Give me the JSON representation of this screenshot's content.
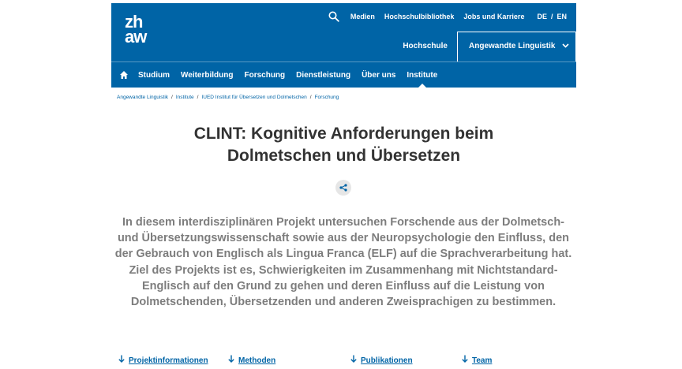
{
  "logo": {
    "line1": "zh",
    "line2": "aw"
  },
  "top_links": {
    "medien": "Medien",
    "bibliothek": "Hochschulbibliothek",
    "jobs": "Jobs und Karriere",
    "lang_de": "DE",
    "lang_sep": "/",
    "lang_en": "EN"
  },
  "subnav": {
    "hochschule": "Hochschule",
    "department": "Angewandte Linguistik"
  },
  "main_nav": {
    "items": [
      "Studium",
      "Weiterbildung",
      "Forschung",
      "Dienstleistung",
      "Über uns",
      "Institute"
    ],
    "active": "Institute"
  },
  "breadcrumb": {
    "items": [
      "Angewandte Linguistik",
      "Institute",
      "IUED Institut für Übersetzen und Dolmetschen",
      "Forschung"
    ],
    "separator": "/"
  },
  "page": {
    "title_line1": "CLINT: Kognitive Anforderungen beim",
    "title_line2": "Dolmetschen und Übersetzen",
    "lead": "In diesem interdisziplinären Projekt untersuchen Forschende aus der Dolmetsch- und Übersetzungswissenschaft sowie aus der Neuropsychologie den Einfluss, den der Gebrauch von Englisch als Lingua Franca (ELF) auf die Sprachverarbeitung hat. Ziel des Projekts ist es, Schwierigkeiten im Zusammenhang mit Nichtstandard-Englisch auf den Grund zu gehen und deren Einfluss auf die Leistung von Dolmetschenden, Übersetzenden und anderen Zweisprachigen zu bestimmen."
  },
  "anchors": {
    "projektinfo": "Projektinformationen",
    "methoden": "Methoden",
    "publikationen": "Publikationen",
    "team": "Team"
  },
  "colors": {
    "brand_blue": "#0064a6",
    "lead_gray": "#7d7d7d",
    "title": "#333333"
  },
  "icons": {
    "search": "search-icon",
    "home": "home-icon",
    "chevron": "chevron-down-icon",
    "share": "share-icon",
    "anchor_arrow": "arrow-down-icon"
  }
}
